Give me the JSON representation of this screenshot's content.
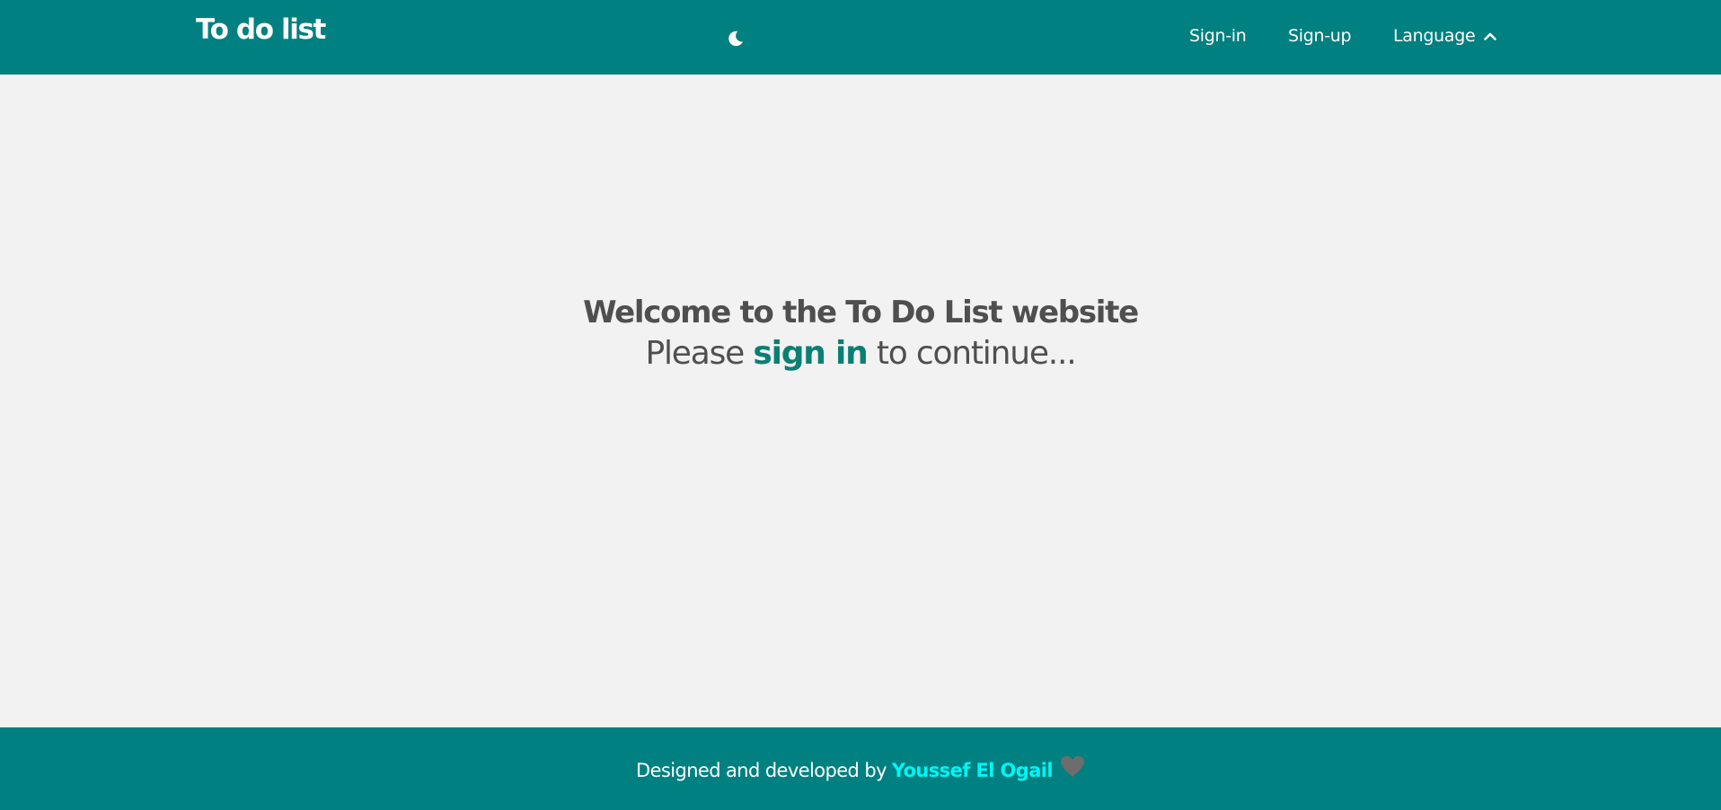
{
  "header": {
    "brand": "To do list",
    "theme_icon": "moon-icon",
    "links": {
      "signin": "Sign-in",
      "signup": "Sign-up",
      "language": "Language",
      "language_icon": "chevron-up-icon"
    }
  },
  "main": {
    "welcome": "Welcome to the To Do List website",
    "prompt_before": "Please ",
    "prompt_link": "sign in",
    "prompt_after": " to continue..."
  },
  "footer": {
    "text": "Designed and developed by",
    "author": "Youssef El Ogail",
    "heart_icon": "heart-icon"
  },
  "colors": {
    "brand_teal": "#008080",
    "background": "#f3f2f2",
    "link_teal": "#0a7f74",
    "author_cyan": "#00f5f5",
    "text_gray": "#4f4f4f",
    "heart_gray": "#6d6d6d"
  }
}
